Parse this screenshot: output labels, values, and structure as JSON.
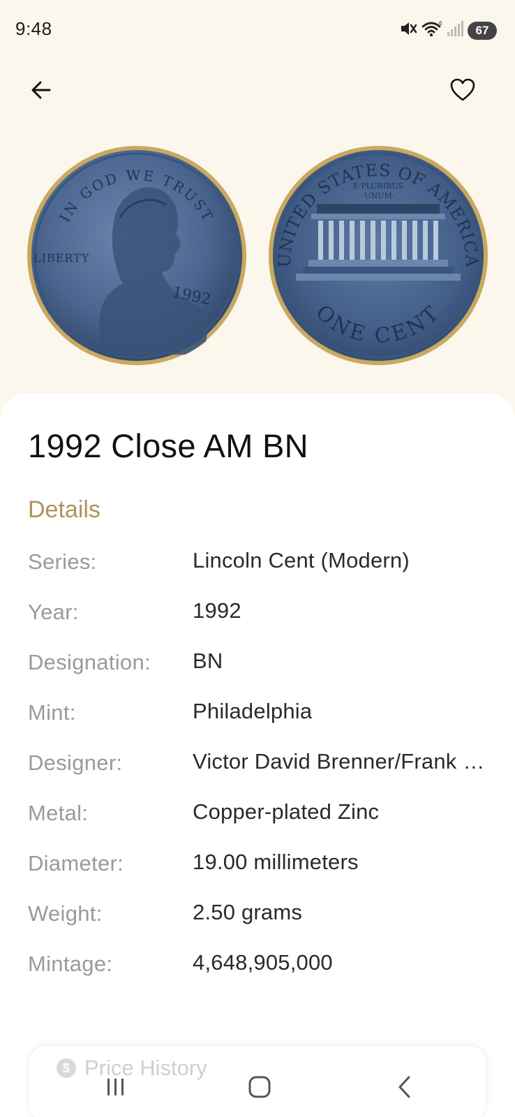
{
  "status_bar": {
    "time": "9:48",
    "battery": "67",
    "icons": [
      "mute-icon",
      "wifi-icon",
      "signal-icon",
      "battery-icon"
    ]
  },
  "header": {
    "back_icon": "arrow-left-icon",
    "favorite_icon": "heart-outline-icon"
  },
  "coin_images": {
    "obverse": {
      "motto": "IN GOD WE TRUST",
      "liberty": "LIBERTY",
      "year": "1992"
    },
    "reverse": {
      "legend": "UNITED STATES OF AMERICA",
      "motto_line1": "E·PLURIBUS",
      "motto_line2": "·UNUM·",
      "denomination": "ONE CENT"
    }
  },
  "coin": {
    "title": "1992 Close AM BN"
  },
  "details": {
    "section_title": "Details",
    "rows": [
      {
        "label": "Series:",
        "value": "Lincoln Cent (Modern)"
      },
      {
        "label": "Year:",
        "value": "1992"
      },
      {
        "label": "Designation:",
        "value": "BN"
      },
      {
        "label": "Mint:",
        "value": "Philadelphia"
      },
      {
        "label": "Designer:",
        "value": "Victor David Brenner/Frank …"
      },
      {
        "label": "Metal:",
        "value": "Copper-plated Zinc"
      },
      {
        "label": "Diameter:",
        "value": "19.00 millimeters"
      },
      {
        "label": "Weight:",
        "value": "2.50 grams"
      },
      {
        "label": "Mintage:",
        "value": "4,648,905,000"
      }
    ]
  },
  "price_history": {
    "label": "Price History",
    "icon_symbol": "$"
  },
  "colors": {
    "background": "#fbf7ec",
    "accent": "#b0935a",
    "coin_rim": "#c9a862",
    "coin_face": "#4b6690"
  }
}
